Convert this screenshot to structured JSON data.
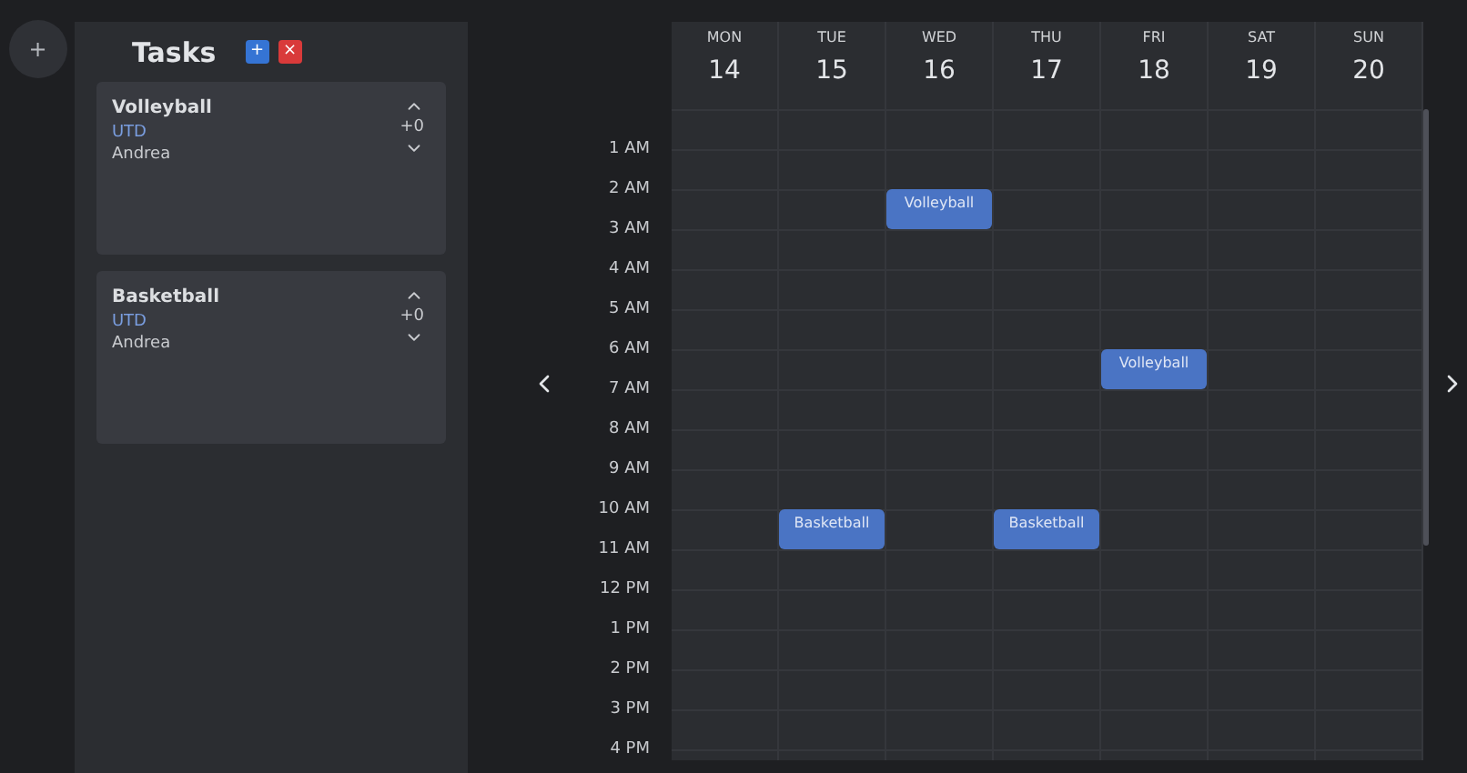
{
  "rail": {
    "add_button": "+"
  },
  "tasks_panel": {
    "title": "Tasks",
    "add_button": "+",
    "delete_button": "×",
    "tasks": [
      {
        "title": "Volleyball",
        "team": "UTD",
        "count": "+0",
        "person": "Andrea"
      },
      {
        "title": "Basketball",
        "team": "UTD",
        "count": "+0",
        "person": "Andrea"
      }
    ]
  },
  "calendar": {
    "days": [
      {
        "name": "MON",
        "date": "14"
      },
      {
        "name": "TUE",
        "date": "15",
        "slots": [
          {
            "kind": "empty"
          },
          {
            "kind": "empty"
          },
          {
            "kind": "empty"
          },
          {
            "kind": "empty"
          },
          {
            "kind": "empty"
          },
          {
            "kind": "empty"
          },
          {
            "kind": "empty"
          },
          {
            "kind": "empty"
          },
          {
            "kind": "empty"
          },
          {
            "kind": "empty"
          },
          {
            "kind": "event",
            "title": "Basketball"
          }
        ]
      },
      {
        "name": "WED",
        "date": "16",
        "slots": [
          {
            "kind": "empty"
          },
          {
            "kind": "empty"
          },
          {
            "kind": "event",
            "title": "Volleyball"
          }
        ]
      },
      {
        "name": "THU",
        "date": "17",
        "slots": [
          {
            "kind": "empty"
          },
          {
            "kind": "empty"
          },
          {
            "kind": "empty"
          },
          {
            "kind": "empty"
          },
          {
            "kind": "empty"
          },
          {
            "kind": "empty"
          },
          {
            "kind": "empty"
          },
          {
            "kind": "empty"
          },
          {
            "kind": "empty"
          },
          {
            "kind": "empty"
          },
          {
            "kind": "event",
            "title": "Basketball"
          }
        ]
      },
      {
        "name": "FRI",
        "date": "18",
        "slots": [
          {
            "kind": "empty"
          },
          {
            "kind": "empty"
          },
          {
            "kind": "empty"
          },
          {
            "kind": "empty"
          },
          {
            "kind": "empty"
          },
          {
            "kind": "empty"
          },
          {
            "kind": "event",
            "title": "Volleyball"
          }
        ]
      },
      {
        "name": "SAT",
        "date": "19"
      },
      {
        "name": "SUN",
        "date": "20"
      }
    ],
    "hours": [
      "1 AM",
      "2 AM",
      "3 AM",
      "4 AM",
      "5 AM",
      "6 AM",
      "7 AM",
      "8 AM",
      "9 AM",
      "10 AM",
      "11 AM",
      "12 PM",
      "1 PM",
      "2 PM",
      "3 PM",
      "4 PM"
    ]
  }
}
